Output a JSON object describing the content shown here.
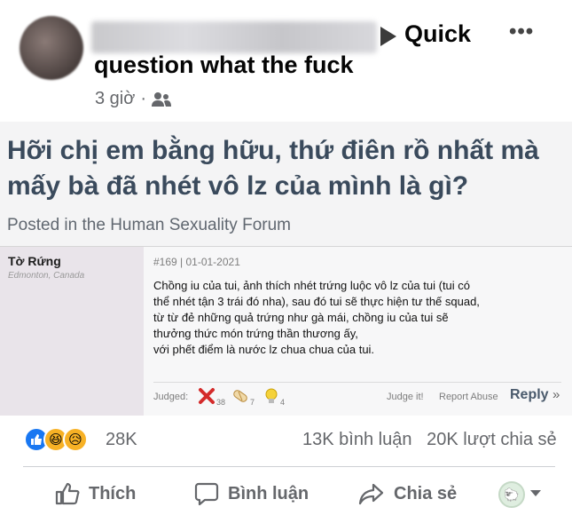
{
  "header": {
    "author_name_blurred": "My Name Is Phin Long",
    "title_part1": "Quick",
    "title_part2": "question what the fuck",
    "time": "3 giờ",
    "privacy_icon": "people-icon",
    "menu_icon": "more-dots-icon"
  },
  "post": {
    "question": "Hỡi chị em bằng hữu, thứ điên rồ nhất mà mấy bà đã nhét vô lz của mình là gì?",
    "posted_in": "Posted in the Human Sexuality Forum",
    "forum": {
      "username": "Tờ Rứng",
      "location": "Edmonton, Canada",
      "post_id": "#169 | 01-01-2021",
      "body_lines": [
        "Chồng iu của tui, ảnh thích nhét trứng luộc vô lz của tui (tui có",
        "thể nhét tận 3 trái đó nha), sau đó tui sẽ thực hiện tư thế squad,",
        "từ từ đẻ những quả trứng như gà mái, chồng iu của tui sẽ",
        "thưởng thức món trứng thần thương ấy,",
        "với phết điểm là nước lz chua chua của tui."
      ],
      "judged_label": "Judged:",
      "judgements": [
        {
          "icon": "red-x-icon",
          "count": "38"
        },
        {
          "icon": "pill-icon",
          "count": "7"
        },
        {
          "icon": "lightbulb-icon",
          "count": "4"
        }
      ],
      "judge_it": "Judge it!",
      "report_abuse": "Report Abuse",
      "reply": "Reply",
      "reply_chevron": "»"
    }
  },
  "reactions": {
    "icons": [
      "like-icon",
      "haha-icon",
      "sad-icon"
    ],
    "count": "28K",
    "comments": "13K bình luận",
    "shares": "20K lượt chia sẻ"
  },
  "actions": {
    "like": "Thích",
    "comment": "Bình luận",
    "share": "Chia sẻ"
  },
  "colors": {
    "like_blue": "#1877f2",
    "emoji_yellow": "#f7b125",
    "question_text": "#3a4a5c"
  }
}
